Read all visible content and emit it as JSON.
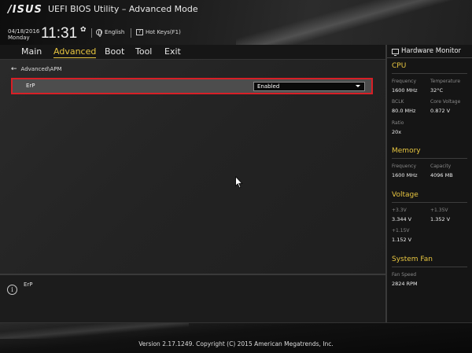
{
  "header": {
    "logo": "/ISUS",
    "title": "UEFI BIOS Utility – Advanced Mode",
    "date": "04/18/2016",
    "weekday": "Monday",
    "time": "11:31",
    "language": "English",
    "hotkeys": "Hot Keys(F1)"
  },
  "menu": {
    "items": [
      "Main",
      "Advanced",
      "Boot",
      "Tool",
      "Exit"
    ],
    "active": "Advanced"
  },
  "main": {
    "breadcrumb": "Advanced\\APM",
    "setting": {
      "label": "ErP",
      "value": "Enabled"
    }
  },
  "help": {
    "text": "ErP"
  },
  "sidebar": {
    "title": "Hardware Monitor",
    "cpu": {
      "title": "CPU",
      "frequency_label": "Frequency",
      "frequency": "1600 MHz",
      "temperature_label": "Temperature",
      "temperature": "32°C",
      "bclk_label": "BCLK",
      "bclk": "80.0 MHz",
      "core_voltage_label": "Core Voltage",
      "core_voltage": "0.872 V",
      "ratio_label": "Ratio",
      "ratio": "20x"
    },
    "memory": {
      "title": "Memory",
      "frequency_label": "Frequency",
      "frequency": "1600 MHz",
      "capacity_label": "Capacity",
      "capacity": "4096 MB"
    },
    "voltage": {
      "title": "Voltage",
      "v33_label": "+3.3V",
      "v33": "3.344 V",
      "v135_label": "+1.35V",
      "v135": "1.352 V",
      "v115_label": "+1.15V",
      "v115": "1.152 V"
    },
    "fan": {
      "title": "System Fan",
      "speed_label": "Fan Speed",
      "speed": "2824 RPM"
    }
  },
  "footer": {
    "version": "Version 2.17.1249. Copyright (C) 2015 American Megatrends, Inc."
  },
  "colors": {
    "accent": "#e8c640",
    "highlight_border": "#d81f26"
  },
  "icons": {
    "gear": "gear-icon",
    "globe": "globe-icon",
    "help": "help-box-icon",
    "back": "arrow-left-icon",
    "info": "info-icon",
    "monitor": "monitor-icon",
    "cursor": "mouse-cursor-icon"
  }
}
